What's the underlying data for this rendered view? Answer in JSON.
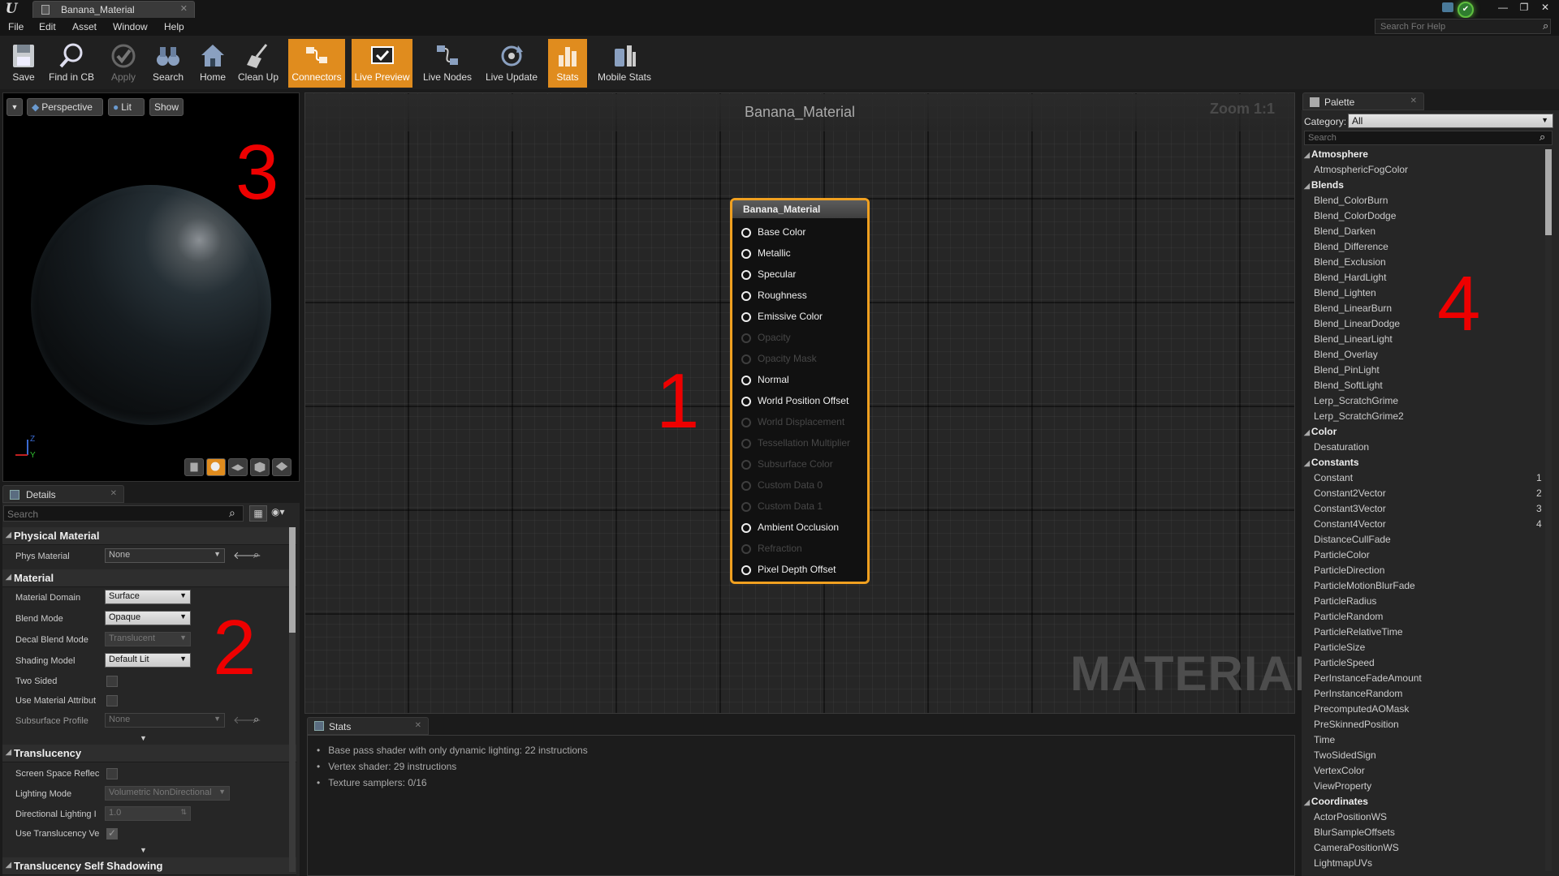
{
  "window": {
    "doc_tab": "Banana_Material",
    "menu": [
      "File",
      "Edit",
      "Asset",
      "Window",
      "Help"
    ],
    "help_search_placeholder": "Search For Help",
    "win_buttons": [
      "—",
      "❐",
      "✕"
    ]
  },
  "toolbar": {
    "buttons": [
      {
        "label": "Save",
        "icon": "save-icon",
        "active": false
      },
      {
        "label": "Find in CB",
        "icon": "magnifier-icon",
        "active": false
      },
      {
        "label": "Apply",
        "icon": "checkmark-icon",
        "active": false
      },
      {
        "label": "Search",
        "icon": "binoculars-icon",
        "active": false
      },
      {
        "label": "Home",
        "icon": "home-icon",
        "active": false
      },
      {
        "label": "Clean Up",
        "icon": "broom-icon",
        "active": false
      },
      {
        "label": "Connectors",
        "icon": "connectors-icon",
        "active": true
      },
      {
        "label": "Live Preview",
        "icon": "live-preview-icon",
        "active": true
      },
      {
        "label": "Live Nodes",
        "icon": "live-nodes-icon",
        "active": false
      },
      {
        "label": "Live Update",
        "icon": "live-update-icon",
        "active": false
      },
      {
        "label": "Stats",
        "icon": "stats-icon",
        "active": true
      },
      {
        "label": "Mobile Stats",
        "icon": "mobile-stats-icon",
        "active": false
      }
    ]
  },
  "viewport": {
    "perspective_label": "Perspective",
    "lit_label": "Lit",
    "show_label": "Show",
    "axis_z": "Z",
    "axis_y": "Y",
    "preview_shapes": [
      "cylinder-icon",
      "sphere-icon",
      "plane-icon",
      "cube-icon",
      "mesh-icon"
    ]
  },
  "details": {
    "tab_label": "Details",
    "search_placeholder": "Search",
    "sections": {
      "physical_material": "Physical Material",
      "material": "Material",
      "translucency": "Translucency",
      "translucency_self_shadowing": "Translucency Self Shadowing"
    },
    "props": {
      "phys_material": {
        "label": "Phys Material",
        "value": "None"
      },
      "material_domain": {
        "label": "Material Domain",
        "value": "Surface"
      },
      "blend_mode": {
        "label": "Blend Mode",
        "value": "Opaque"
      },
      "decal_blend_mode": {
        "label": "Decal Blend Mode",
        "value": "Translucent"
      },
      "shading_model": {
        "label": "Shading Model",
        "value": "Default Lit"
      },
      "two_sided": {
        "label": "Two Sided"
      },
      "use_material_attributes": {
        "label": "Use Material Attribut"
      },
      "subsurface_profile": {
        "label": "Subsurface Profile",
        "value": "None"
      },
      "screen_space_reflections": {
        "label": "Screen Space Reflec"
      },
      "lighting_mode": {
        "label": "Lighting Mode",
        "value": "Volumetric NonDirectional"
      },
      "directional_lighting": {
        "label": "Directional Lighting I",
        "value": "1.0"
      },
      "use_translucency": {
        "label": "Use Translucency Ve"
      }
    }
  },
  "graph": {
    "title": "Banana_Material",
    "zoom": "Zoom 1:1",
    "watermark": "MATERIAL",
    "node": {
      "title": "Banana_Material",
      "pins": [
        {
          "label": "Base Color",
          "enabled": true
        },
        {
          "label": "Metallic",
          "enabled": true
        },
        {
          "label": "Specular",
          "enabled": true
        },
        {
          "label": "Roughness",
          "enabled": true
        },
        {
          "label": "Emissive Color",
          "enabled": true
        },
        {
          "label": "Opacity",
          "enabled": false
        },
        {
          "label": "Opacity Mask",
          "enabled": false
        },
        {
          "label": "Normal",
          "enabled": true
        },
        {
          "label": "World Position Offset",
          "enabled": true
        },
        {
          "label": "World Displacement",
          "enabled": false
        },
        {
          "label": "Tessellation Multiplier",
          "enabled": false
        },
        {
          "label": "Subsurface Color",
          "enabled": false
        },
        {
          "label": "Custom Data 0",
          "enabled": false
        },
        {
          "label": "Custom Data 1",
          "enabled": false
        },
        {
          "label": "Ambient Occlusion",
          "enabled": true
        },
        {
          "label": "Refraction",
          "enabled": false
        },
        {
          "label": "Pixel Depth Offset",
          "enabled": true
        }
      ]
    }
  },
  "annotations": [
    "1",
    "2",
    "3",
    "4"
  ],
  "stats": {
    "tab_label": "Stats",
    "lines": [
      "Base pass shader with only dynamic lighting: 22 instructions",
      "Vertex shader: 29 instructions",
      "Texture samplers: 0/16"
    ]
  },
  "palette": {
    "tab_label": "Palette",
    "category_label": "Category:",
    "category_value": "All",
    "search_placeholder": "Search",
    "groups": [
      {
        "name": "Atmosphere",
        "items": [
          {
            "label": "AtmosphericFogColor"
          }
        ]
      },
      {
        "name": "Blends",
        "items": [
          {
            "label": "Blend_ColorBurn"
          },
          {
            "label": "Blend_ColorDodge"
          },
          {
            "label": "Blend_Darken"
          },
          {
            "label": "Blend_Difference"
          },
          {
            "label": "Blend_Exclusion"
          },
          {
            "label": "Blend_HardLight"
          },
          {
            "label": "Blend_Lighten"
          },
          {
            "label": "Blend_LinearBurn"
          },
          {
            "label": "Blend_LinearDodge"
          },
          {
            "label": "Blend_LinearLight"
          },
          {
            "label": "Blend_Overlay"
          },
          {
            "label": "Blend_PinLight"
          },
          {
            "label": "Blend_SoftLight"
          },
          {
            "label": "Lerp_ScratchGrime"
          },
          {
            "label": "Lerp_ScratchGrime2"
          }
        ]
      },
      {
        "name": "Color",
        "items": [
          {
            "label": "Desaturation"
          }
        ]
      },
      {
        "name": "Constants",
        "items": [
          {
            "label": "Constant",
            "hotkey": "1"
          },
          {
            "label": "Constant2Vector",
            "hotkey": "2"
          },
          {
            "label": "Constant3Vector",
            "hotkey": "3"
          },
          {
            "label": "Constant4Vector",
            "hotkey": "4"
          },
          {
            "label": "DistanceCullFade"
          },
          {
            "label": "ParticleColor"
          },
          {
            "label": "ParticleDirection"
          },
          {
            "label": "ParticleMotionBlurFade"
          },
          {
            "label": "ParticleRadius"
          },
          {
            "label": "ParticleRandom"
          },
          {
            "label": "ParticleRelativeTime"
          },
          {
            "label": "ParticleSize"
          },
          {
            "label": "ParticleSpeed"
          },
          {
            "label": "PerInstanceFadeAmount"
          },
          {
            "label": "PerInstanceRandom"
          },
          {
            "label": "PrecomputedAOMask"
          },
          {
            "label": "PreSkinnedPosition"
          },
          {
            "label": "Time"
          },
          {
            "label": "TwoSidedSign"
          },
          {
            "label": "VertexColor"
          },
          {
            "label": "ViewProperty"
          }
        ]
      },
      {
        "name": "Coordinates",
        "items": [
          {
            "label": "ActorPositionWS"
          },
          {
            "label": "BlurSampleOffsets"
          },
          {
            "label": "CameraPositionWS"
          },
          {
            "label": "LightmapUVs"
          }
        ]
      }
    ]
  },
  "colors": {
    "accent_orange": "#e08c1e",
    "node_border": "#f0a020",
    "annotation_red": "#ee0000"
  }
}
